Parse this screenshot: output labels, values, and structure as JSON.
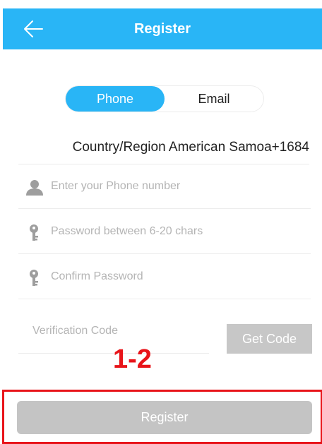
{
  "header": {
    "title": "Register",
    "back_icon": "arrow-left-icon",
    "background": "#29b5f6"
  },
  "toggle": {
    "options": [
      "Phone",
      "Email"
    ],
    "selected": "Phone"
  },
  "country": {
    "label": "Country/Region",
    "value": "American Samoa+1684"
  },
  "fields": {
    "phone": {
      "placeholder": "Enter your Phone number",
      "icon": "user-icon"
    },
    "password": {
      "placeholder": "Password between 6-20 chars",
      "icon": "key-icon"
    },
    "confirm": {
      "placeholder": "Confirm Password",
      "icon": "key-icon"
    },
    "verification": {
      "placeholder": "Verification Code"
    }
  },
  "get_code_label": "Get Code",
  "annotation": "1-2",
  "register_label": "Register",
  "colors": {
    "accent": "#29b5f6",
    "disabled_button": "#c4c4c4",
    "annotation_red": "#e8141a"
  }
}
